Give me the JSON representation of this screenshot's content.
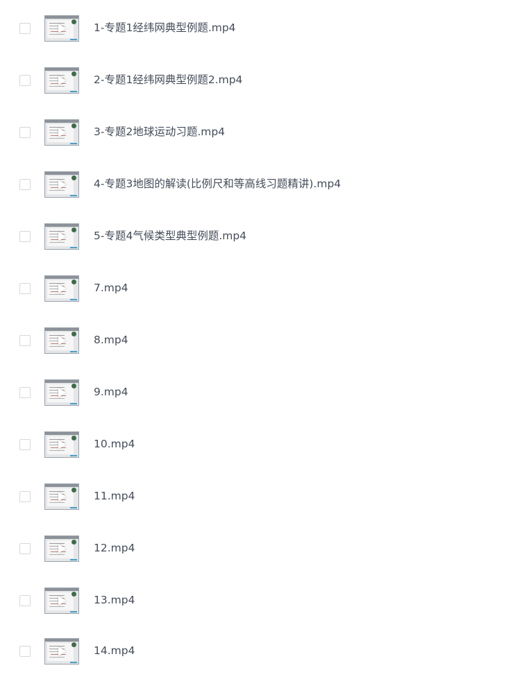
{
  "files": [
    {
      "name": "1-专题1经纬网典型例题.mp4"
    },
    {
      "name": "2-专题1经纬网典型例题2.mp4"
    },
    {
      "name": "3-专题2地球运动习题.mp4"
    },
    {
      "name": "4-专题3地图的解读(比例尺和等高线习题精讲).mp4"
    },
    {
      "name": "5-专题4气候类型典型例题.mp4"
    },
    {
      "name": "7.mp4"
    },
    {
      "name": "8.mp4"
    },
    {
      "name": "9.mp4"
    },
    {
      "name": "10.mp4"
    },
    {
      "name": "11.mp4"
    },
    {
      "name": "12.mp4"
    },
    {
      "name": "13.mp4"
    },
    {
      "name": "14.mp4"
    }
  ],
  "icons": {
    "checkbox": "checkbox-icon",
    "thumbnail": "video-thumbnail",
    "play": "play-icon"
  },
  "colors": {
    "text": "#454d5a",
    "checkbox_border": "#d4d7de",
    "background": "#ffffff"
  }
}
